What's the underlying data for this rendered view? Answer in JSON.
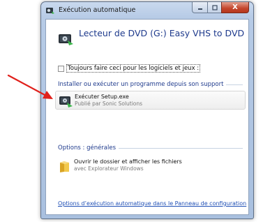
{
  "window": {
    "title": "Exécution automatique",
    "caption_buttons": {
      "minimize_icon": "minimize-icon",
      "maximize_icon": "maximize-icon",
      "close_label": "X"
    }
  },
  "device": {
    "title": "Lecteur de DVD (G:) Easy VHS to DVD",
    "icon": "dvd-drive-icon"
  },
  "checkbox": {
    "label": "Toujours faire ceci pour les logiciels et jeux :",
    "checked": false
  },
  "sections": [
    {
      "header": "Installer ou exécuter un programme depuis son support",
      "items": [
        {
          "main": "Exécuter Setup.exe",
          "sub": "Publié par Sonic Solutions",
          "icon": "setup-program-icon",
          "highlighted": true
        }
      ]
    },
    {
      "header": "Options : générales",
      "items": [
        {
          "main": "Ouvrir le dossier et afficher les fichiers",
          "sub": "avec Explorateur Windows",
          "icon": "folder-icon",
          "highlighted": false
        }
      ]
    }
  ],
  "footer_link": "Options d’exécution automatique dans le Panneau de configuration",
  "annotation": {
    "type": "arrow",
    "color": "#e0201b"
  },
  "colors": {
    "heading_blue": "#1e3a8c",
    "link_blue": "#1f4fb5",
    "close_red": "#c4452b"
  }
}
